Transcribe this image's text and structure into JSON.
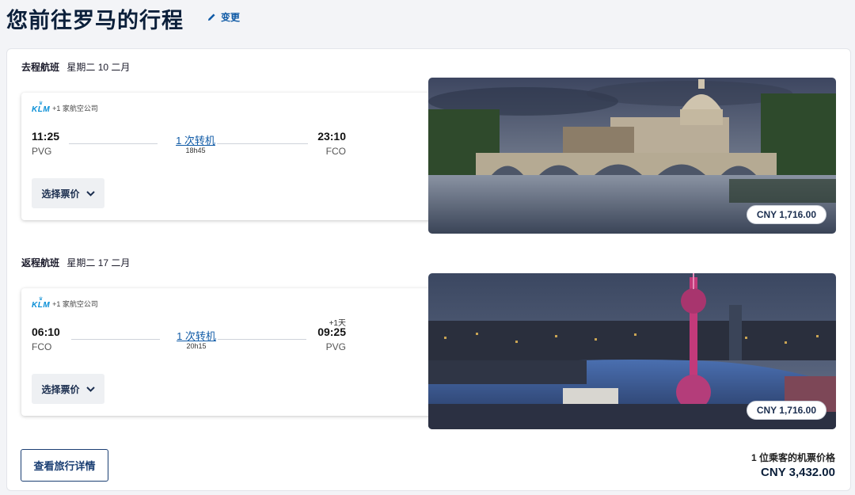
{
  "page": {
    "title": "您前往罗马的行程",
    "edit_label": "变更"
  },
  "outbound": {
    "heading": "去程航班",
    "date": "星期二 10 二月",
    "airline_logo": "KLM",
    "airline_extra": "+1 家航空公司",
    "dep_time": "11:25",
    "dep_code": "PVG",
    "stops": "1 次转机",
    "duration": "18h45",
    "arr_time": "23:10",
    "arr_code": "FCO",
    "plus_day": "",
    "fare_button": "选择票价",
    "price": "CNY 1,716.00"
  },
  "return": {
    "heading": "返程航班",
    "date": "星期二 17 二月",
    "airline_logo": "KLM",
    "airline_extra": "+1 家航空公司",
    "dep_time": "06:10",
    "dep_code": "FCO",
    "stops": "1 次转机",
    "duration": "20h15",
    "arr_time": "09:25",
    "arr_code": "PVG",
    "plus_day": "+1天",
    "fare_button": "选择票价",
    "price": "CNY 1,716.00"
  },
  "footer": {
    "details_button": "查看旅行详情",
    "total_label": "1 位乘客的机票价格",
    "total_price": "CNY 3,432.00"
  },
  "icons": {
    "edit": "pencil-icon",
    "fare_toggle": "chevron-down-icon"
  },
  "colors": {
    "link": "#0f5aa6",
    "brand_klm": "#0a8fd6",
    "navy": "#1b3f73"
  }
}
